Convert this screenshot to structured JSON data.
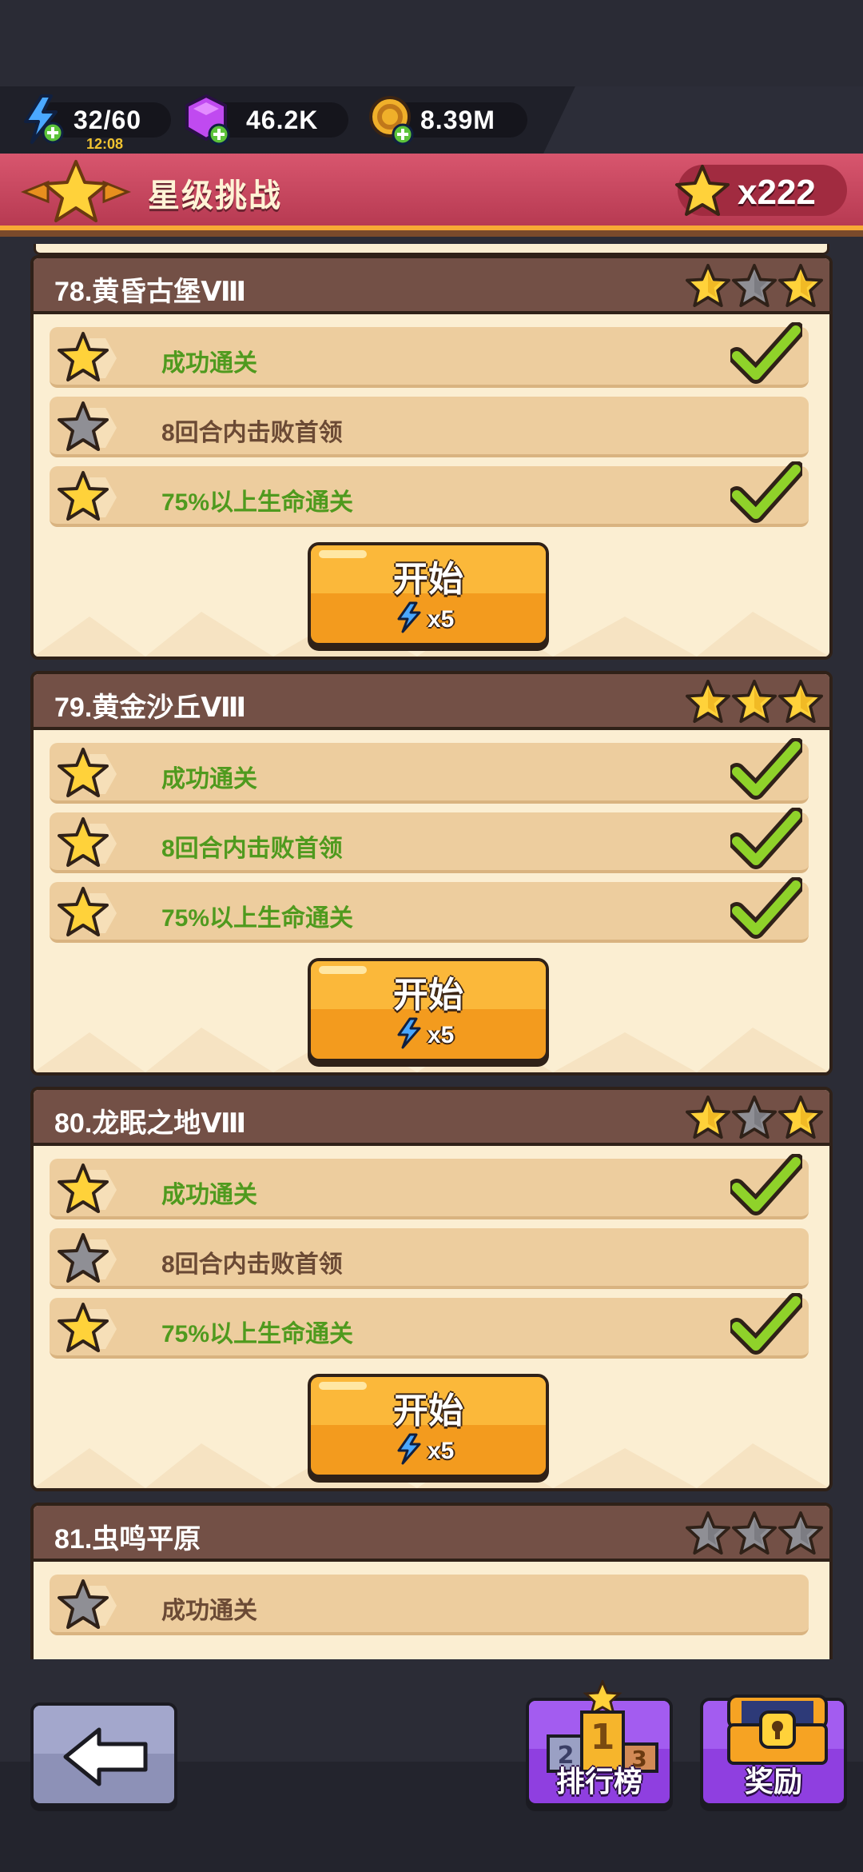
{
  "resources": {
    "energy": {
      "value": "32/60",
      "timer": "12:08",
      "icon": "lightning-plus-icon"
    },
    "gems": {
      "value": "46.2K",
      "icon": "gem-plus-icon"
    },
    "coins": {
      "value": "8.39M",
      "icon": "coin-plus-icon"
    }
  },
  "header": {
    "title": "星级挑战",
    "star_total": "x222"
  },
  "stages": [
    {
      "title": "78.黄昏古堡Ⅷ",
      "stars": [
        true,
        false,
        true
      ],
      "conditions": [
        {
          "text": "成功通关",
          "done": true
        },
        {
          "text": "8回合内击败首领",
          "done": false
        },
        {
          "text": "75%以上生命通关",
          "done": true
        }
      ],
      "start_label": "开始",
      "cost": "x5"
    },
    {
      "title": "79.黄金沙丘Ⅷ",
      "stars": [
        true,
        true,
        true
      ],
      "conditions": [
        {
          "text": "成功通关",
          "done": true
        },
        {
          "text": "8回合内击败首领",
          "done": true
        },
        {
          "text": "75%以上生命通关",
          "done": true
        }
      ],
      "start_label": "开始",
      "cost": "x5"
    },
    {
      "title": "80.龙眠之地Ⅷ",
      "stars": [
        true,
        false,
        true
      ],
      "conditions": [
        {
          "text": "成功通关",
          "done": true
        },
        {
          "text": "8回合内击败首领",
          "done": false
        },
        {
          "text": "75%以上生命通关",
          "done": true
        }
      ],
      "start_label": "开始",
      "cost": "x5"
    },
    {
      "title": "81.虫鸣平原",
      "stars": [
        false,
        false,
        false
      ],
      "conditions": [
        {
          "text": "成功通关",
          "done": false
        }
      ]
    }
  ],
  "bottom": {
    "back_icon": "back-arrow-icon",
    "leaderboard_label": "排行榜",
    "rewards_label": "奖励"
  },
  "colors": {
    "header_red": "#c8465f",
    "card_bg": "#fbeed2",
    "card_head": "#735046",
    "done_green": "#4f9a1e",
    "todo_brown": "#6b4a35",
    "button_orange": "#f39b1e",
    "nav_purple": "#8f3fe0"
  }
}
